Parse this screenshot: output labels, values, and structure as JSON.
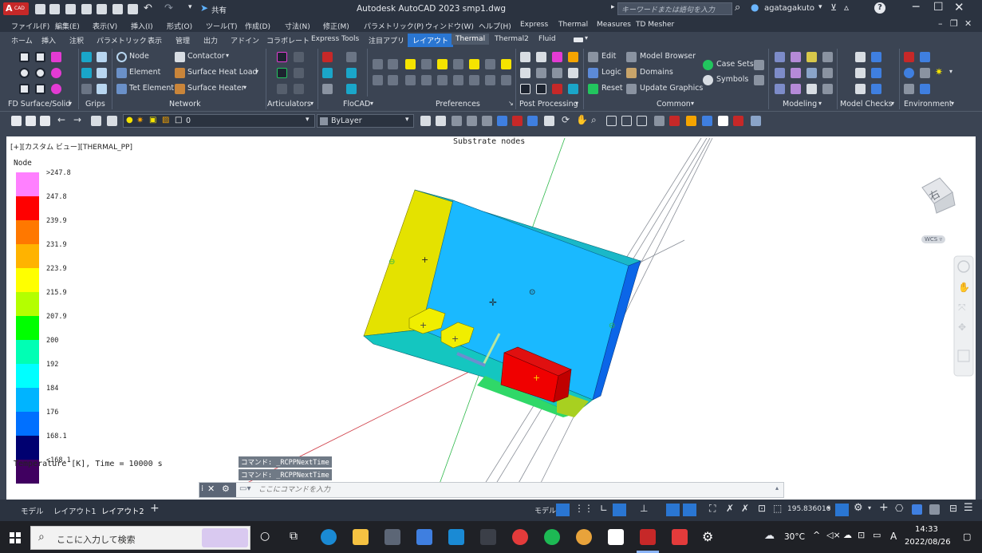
{
  "titlebar": {
    "app_label": "A",
    "app_sub": "CAD",
    "share": "共有",
    "title": "Autodesk AutoCAD 2023   smp1.dwg",
    "search_placeholder": "キーワードまたは語句を入力",
    "user": "agatagakuto",
    "help": "?"
  },
  "menu": [
    "ファイル(F)",
    "編集(E)",
    "表示(V)",
    "挿入(I)",
    "形式(O)",
    "ツール(T)",
    "作成(D)",
    "寸法(N)",
    "修正(M)",
    "パラメトリック(P)",
    "ウィンドウ(W)",
    "ヘルプ(H)",
    "Express",
    "Thermal",
    "Measures",
    "TD Mesher"
  ],
  "ribbon_tabs": [
    "ホーム",
    "挿入",
    "注釈",
    "パラメトリック",
    "表示",
    "管理",
    "出力",
    "アドイン",
    "コラボレート",
    "Express Tools",
    "注目アプリ",
    "レイアウト",
    "Thermal",
    "Thermal2",
    "Fluid"
  ],
  "ribbon": {
    "node": "Node",
    "element": "Element",
    "tet_element": "Tet Element",
    "contactor": "Contactor",
    "surface_heat_load": "Surface Heat Load",
    "surface_heater": "Surface Heater",
    "edit": "Edit",
    "logic": "Logic",
    "reset": "Reset",
    "model_browser": "Model Browser",
    "domains": "Domains",
    "update_graphics": "Update Graphics",
    "case_sets": "Case Sets",
    "symbols": "Symbols",
    "panels": [
      "FD Surface/Solid",
      "Grips",
      "Network",
      "Articulators",
      "FloCAD",
      "Preferences",
      "Post Processing",
      "Common",
      "Modeling",
      "Model Checks",
      "Environment"
    ]
  },
  "props": {
    "layer": "0",
    "color": "ByLayer"
  },
  "viewport": {
    "view_label": "[+][カスタム ビュー][THERMAL_PP]",
    "plot_title": "Substrate nodes",
    "legend_title": "Node",
    "legend_footer": "Temperature [K], Time = 10000 s",
    "viewcube": "右",
    "wcs": "WCS"
  },
  "legend": {
    "labels": [
      ">247.8",
      "247.8",
      "239.9",
      "231.9",
      "223.9",
      "215.9",
      "207.9",
      "200",
      "192",
      "184",
      "176",
      "168.1",
      "<168.1"
    ],
    "colors": [
      "#ff80ff",
      "#ff0000",
      "#ff7800",
      "#ffb300",
      "#ffff00",
      "#b4ff00",
      "#00ff00",
      "#00ffb4",
      "#00ffff",
      "#00b4ff",
      "#0070ff",
      "#000070",
      "#400060"
    ]
  },
  "command": {
    "history": [
      "コマンド: _RCPPNextTime",
      "コマンド: _RCPPNextTime"
    ],
    "placeholder": "ここにコマンドを入力"
  },
  "layout_tabs": [
    "モデル",
    "レイアウト1",
    "レイアウト2"
  ],
  "status": {
    "model": "モデル",
    "scale": "195.836016"
  },
  "taskbar": {
    "search_placeholder": "ここに入力して検索",
    "weather": "30°C",
    "ime": "A",
    "time": "14:33",
    "date": "2022/08/26"
  }
}
